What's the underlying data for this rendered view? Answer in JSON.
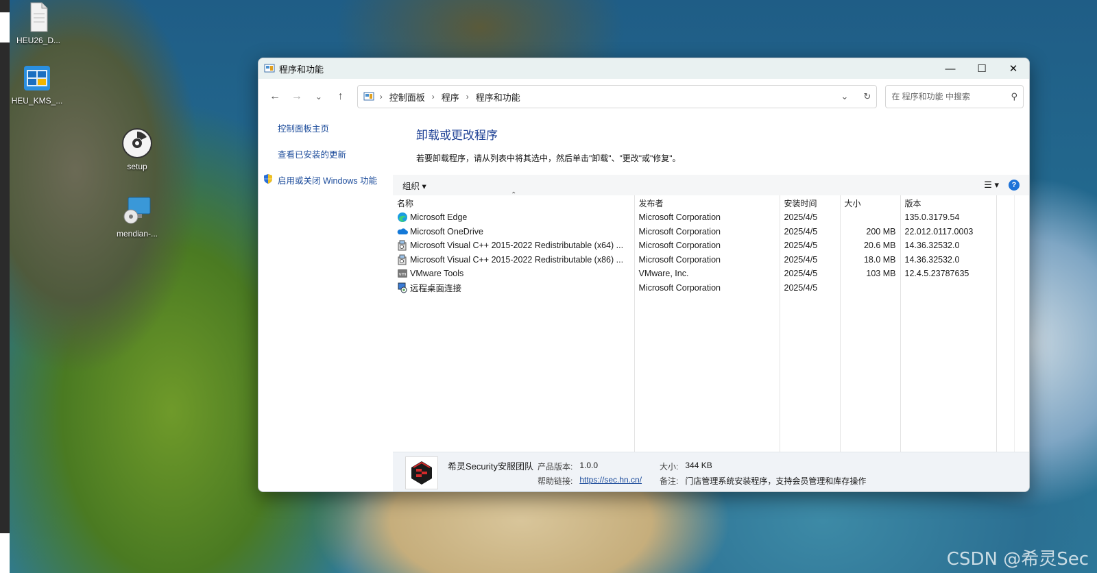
{
  "desktop": {
    "icons": [
      {
        "label": "HEU26_D...",
        "icon": "file-icon"
      },
      {
        "label": "HEU_KMS_...",
        "icon": "heu-kms-icon"
      },
      {
        "label": "setup",
        "icon": "disc-setup-icon"
      },
      {
        "label": "mendian-...",
        "icon": "installer-icon"
      }
    ],
    "watermark": "CSDN @希灵Sec"
  },
  "window": {
    "title": "程序和功能",
    "controls": {
      "minimize": "—",
      "maximize": "☐",
      "close": "✕"
    },
    "breadcrumb": [
      "控制面板",
      "程序",
      "程序和功能"
    ],
    "search_placeholder": "在 程序和功能 中搜索",
    "sidebar": {
      "home": "控制面板主页",
      "updates": "查看已安装的更新",
      "features": "启用或关闭 Windows 功能"
    },
    "heading": "卸载或更改程序",
    "description": "若要卸载程序，请从列表中将其选中，然后单击\"卸载\"、\"更改\"或\"修复\"。",
    "toolbar": {
      "organize": "组织 ▾"
    },
    "columns": [
      "名称",
      "发布者",
      "安装时间",
      "大小",
      "版本"
    ],
    "programs": [
      {
        "name": "Microsoft Edge",
        "publisher": "Microsoft Corporation",
        "date": "2025/4/5",
        "size": "",
        "version": "135.0.3179.54",
        "icon": "edge-icon"
      },
      {
        "name": "Microsoft OneDrive",
        "publisher": "Microsoft Corporation",
        "date": "2025/4/5",
        "size": "200 MB",
        "version": "22.012.0117.0003",
        "icon": "onedrive-icon"
      },
      {
        "name": "Microsoft Visual C++ 2015-2022 Redistributable (x64) ...",
        "publisher": "Microsoft Corporation",
        "date": "2025/4/5",
        "size": "20.6 MB",
        "version": "14.36.32532.0",
        "icon": "installer-package-icon"
      },
      {
        "name": "Microsoft Visual C++ 2015-2022 Redistributable (x86) ...",
        "publisher": "Microsoft Corporation",
        "date": "2025/4/5",
        "size": "18.0 MB",
        "version": "14.36.32532.0",
        "icon": "installer-package-icon"
      },
      {
        "name": "VMware Tools",
        "publisher": "VMware, Inc.",
        "date": "2025/4/5",
        "size": "103 MB",
        "version": "12.4.5.23787635",
        "icon": "vmware-icon"
      },
      {
        "name": "远程桌面连接",
        "publisher": "Microsoft Corporation",
        "date": "2025/4/5",
        "size": "",
        "version": "",
        "icon": "remote-desktop-icon"
      }
    ],
    "details": {
      "publisher": "希灵Security安服团队",
      "version_label": "产品版本:",
      "version": "1.0.0",
      "help_label": "帮助链接:",
      "help_link": "https://sec.hn.cn/",
      "size_label": "大小:",
      "size": "344 KB",
      "comment_label": "备注:",
      "comment": "门店管理系统安装程序，支持会员管理和库存操作"
    }
  },
  "colors": {
    "link": "#1a4a9a",
    "heading": "#1c3f94",
    "titlebar": "#e9f1f1"
  }
}
